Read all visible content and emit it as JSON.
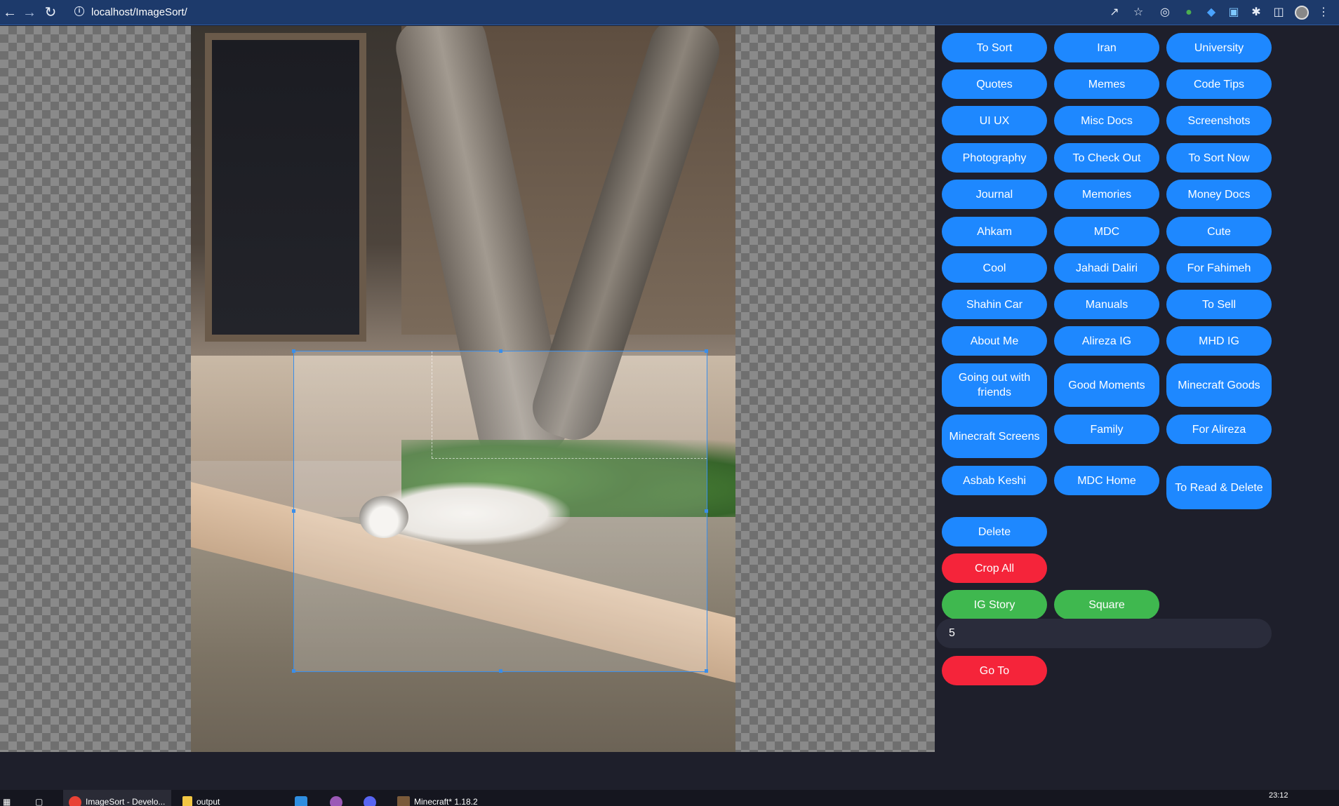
{
  "browser": {
    "url": "localhost/ImageSort/",
    "back_icon": "arrow-left-icon",
    "forward_icon": "arrow-right-icon",
    "reload_icon": "reload-icon",
    "info_icon": "info-icon"
  },
  "viewer": {
    "image_subject": "cat"
  },
  "categories": [
    [
      "To Sort",
      "Iran",
      "University"
    ],
    [
      "Quotes",
      "Memes",
      "Code Tips"
    ],
    [
      "UI UX",
      "Misc Docs",
      "Screenshots"
    ],
    [
      "Photography",
      "To Check Out",
      "To Sort Now"
    ],
    [
      "Journal",
      "Memories",
      "Money Docs"
    ],
    [
      "Ahkam",
      "MDC",
      "Cute"
    ],
    [
      "Cool",
      "Jahadi Daliri",
      "For Fahimeh"
    ],
    [
      "Shahin Car",
      "Manuals",
      "To Sell"
    ],
    [
      "About Me",
      "Alireza IG",
      "MHD IG"
    ],
    [
      "Going out with friends",
      "Good Moments",
      "Minecraft Goods"
    ],
    [
      "Minecraft Screens",
      "Family",
      "For Alireza"
    ],
    [
      "Asbab Keshi",
      "MDC Home",
      "To Read & Delete"
    ]
  ],
  "actions": {
    "delete": "Delete",
    "crop_all": "Crop All",
    "ig_story": "IG Story",
    "square": "Square",
    "goto_value": "5",
    "go_to": "Go To"
  },
  "colors": {
    "primary": "#1e88ff",
    "danger": "#f5243a",
    "success": "#3fb84f",
    "background": "#1e1f2b"
  },
  "taskbar": {
    "items": [
      "ImageSort - Develo...",
      "output",
      "Minecraft* 1.18.2"
    ],
    "clock": "23:12"
  }
}
